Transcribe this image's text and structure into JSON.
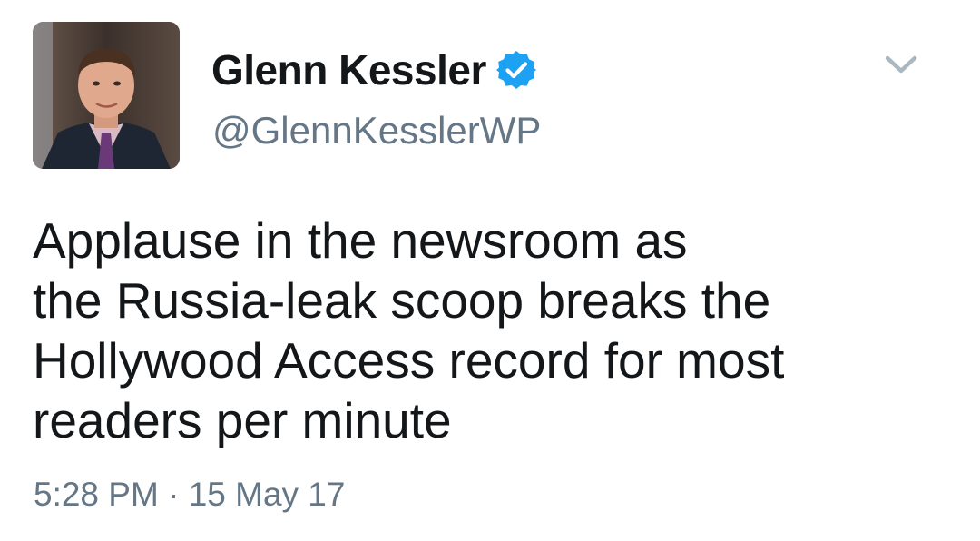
{
  "author": {
    "display_name": "Glenn Kessler",
    "handle": "@GlennKesslerWP",
    "verified": true,
    "avatar_icon": "profile-photo",
    "verified_icon": "verified-badge-icon",
    "verified_color": "#1da1f2"
  },
  "menu": {
    "icon": "chevron-down-icon"
  },
  "tweet": {
    "lines": [
      "Applause in the newsroom as",
      "the Russia-leak scoop breaks the",
      "Hollywood Access record for most",
      "readers per minute"
    ],
    "time": "5:28 PM",
    "separator": "·",
    "date": "15 May 17"
  },
  "colors": {
    "text_primary": "#14171a",
    "text_secondary": "#657786",
    "background": "#ffffff"
  }
}
